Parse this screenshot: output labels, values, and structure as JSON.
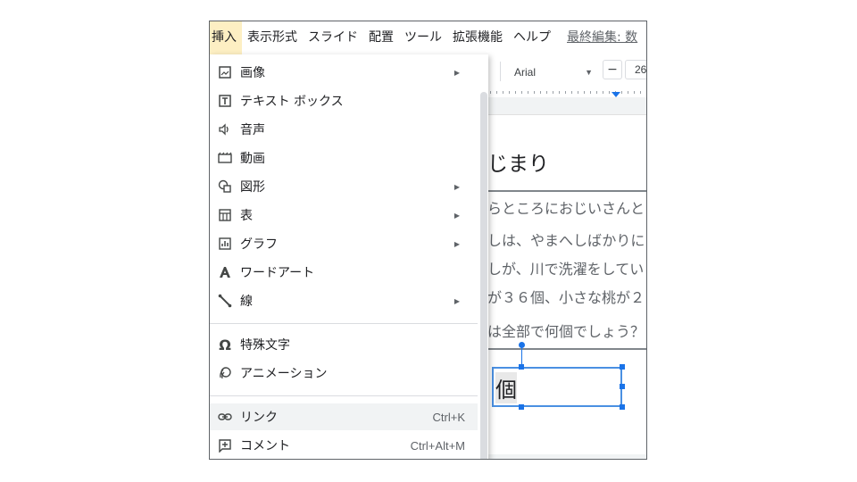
{
  "menubar": {
    "items": [
      "挿入",
      "表示形式",
      "スライド",
      "配置",
      "ツール",
      "拡張機能",
      "ヘルプ"
    ],
    "last_edit": "最終編集: 数"
  },
  "toolbar": {
    "font": "Arial",
    "size_minus": "−",
    "font_size": "26"
  },
  "slide": {
    "title": "じまり",
    "lines": [
      "らところにおじいさんと",
      "しは、やまへしばかりに",
      "しが、川で洗濯をしてい",
      "が３６個、小さな桃が２",
      "は全部で何個でしょう？"
    ],
    "answer": "個"
  },
  "menu": {
    "items": [
      {
        "icon": "image-icon",
        "label": "画像",
        "submenu": true
      },
      {
        "icon": "text-box-icon",
        "label": "テキスト ボックス",
        "submenu": false
      },
      {
        "icon": "audio-icon",
        "label": "音声",
        "submenu": false
      },
      {
        "icon": "video-icon",
        "label": "動画",
        "submenu": false
      },
      {
        "icon": "shape-icon",
        "label": "図形",
        "submenu": true
      },
      {
        "icon": "table-icon",
        "label": "表",
        "submenu": true
      },
      {
        "icon": "chart-icon",
        "label": "グラフ",
        "submenu": true
      },
      {
        "icon": "word-art-icon",
        "label": "ワードアート",
        "submenu": false
      },
      {
        "icon": "line-icon",
        "label": "線",
        "submenu": true
      },
      {
        "icon": "omega-icon",
        "label": "特殊文字",
        "submenu": false
      },
      {
        "icon": "animation-icon",
        "label": "アニメーション",
        "submenu": false
      },
      {
        "icon": "link-icon",
        "label": "リンク",
        "shortcut": "Ctrl+K",
        "highlighted": true
      },
      {
        "icon": "comment-icon",
        "label": "コメント",
        "shortcut": "Ctrl+Alt+M"
      }
    ],
    "submenu_arrow": "▶"
  },
  "colors": {
    "active_menu_bg": "#fdefc3",
    "highlight_bg": "#f1f3f4",
    "selection_blue": "#1a73e8"
  }
}
